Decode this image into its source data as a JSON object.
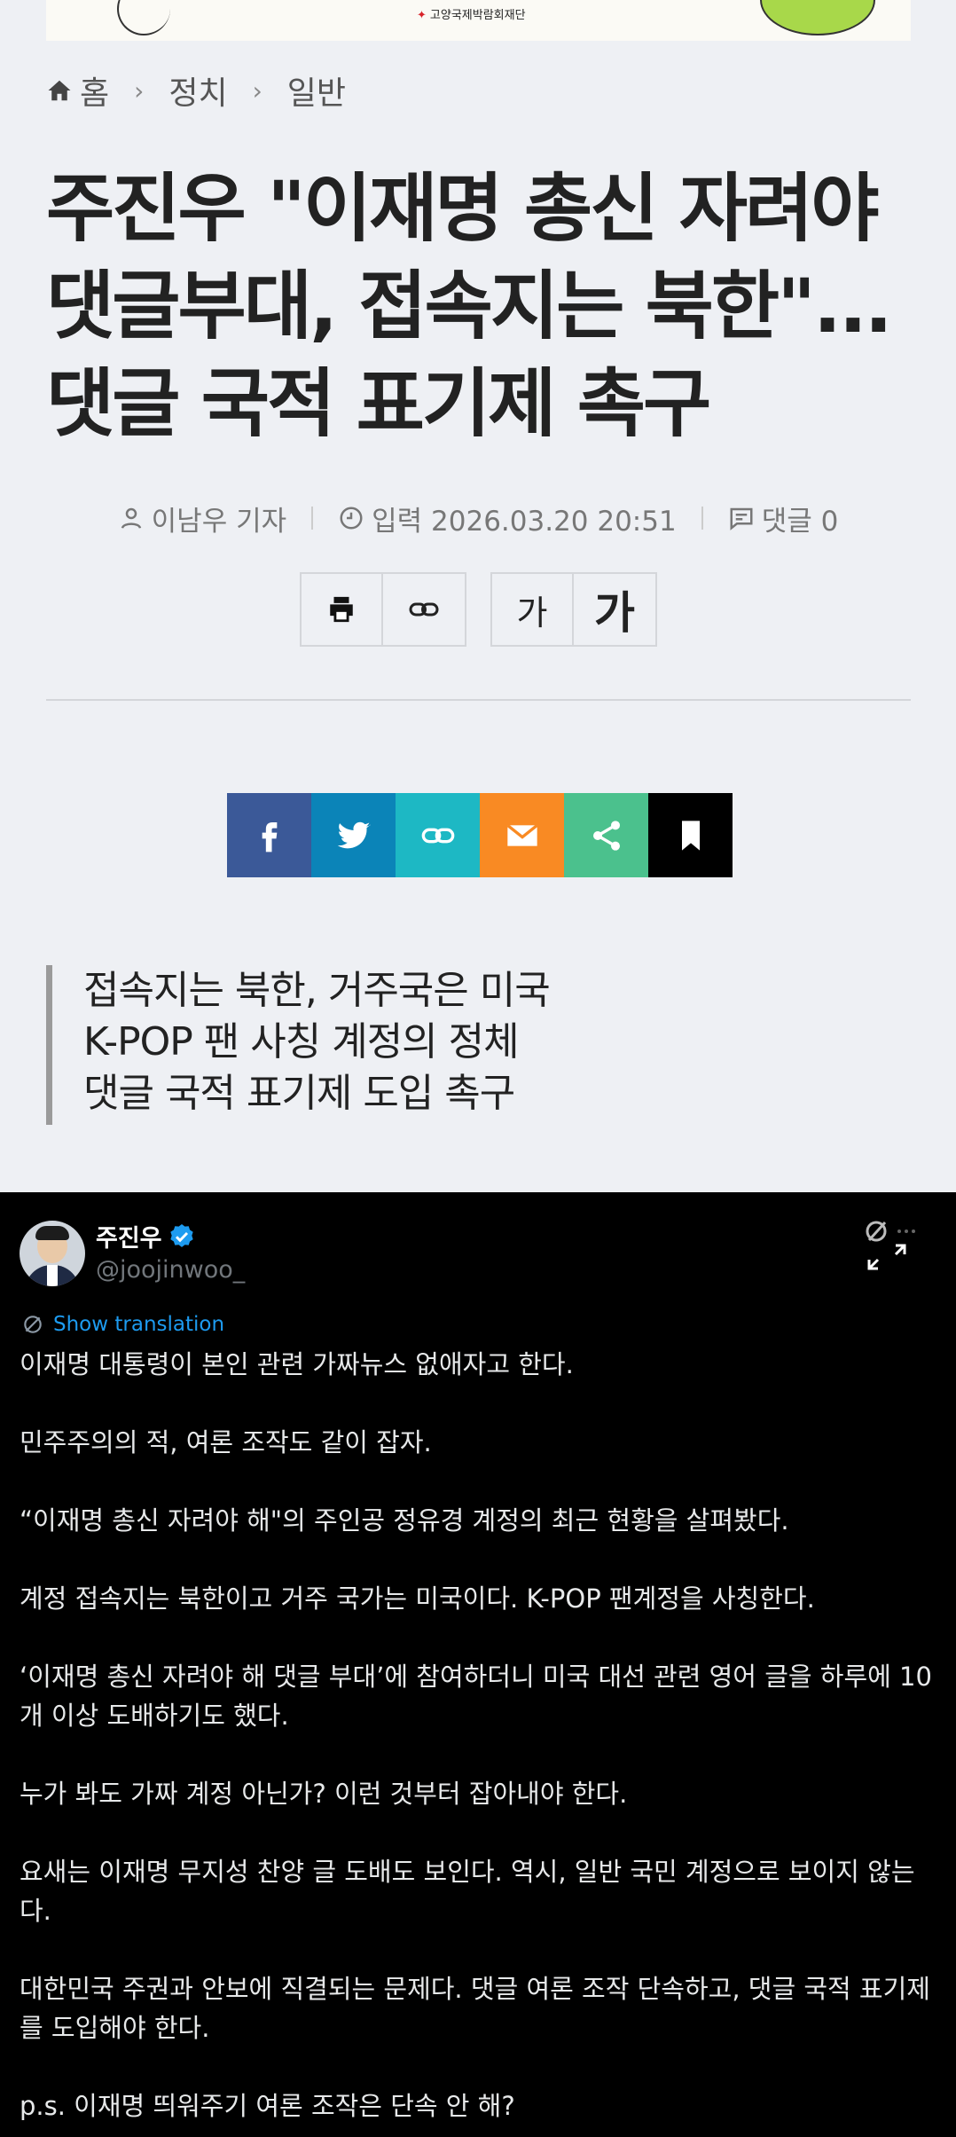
{
  "banner": {
    "logo_text": "고양국제박람회재단"
  },
  "breadcrumb": {
    "home": "홈",
    "section": "정치",
    "subsection": "일반"
  },
  "article": {
    "title": "주진우 \"이재명 총신 자려야 댓글부대, 접속지는 북한\"...댓글 국적 표기제 촉구",
    "author": "이남우 기자",
    "date": "입력 2026.03.20 20:51",
    "comments": "댓글 0"
  },
  "tools": {
    "font_small": "가",
    "font_large": "가"
  },
  "share": {
    "colors": {
      "facebook": "#3b5998",
      "twitter": "#0b84b8",
      "link": "#1db8c4",
      "email": "#f98a23",
      "share": "#4bc18d",
      "bookmark": "#000000"
    }
  },
  "summary": {
    "lines": [
      "접속지는 북한, 거주국은 미국",
      "K-POP 팬 사칭 계정의 정체",
      "댓글 국적 표기제 도입 촉구"
    ]
  },
  "tweet": {
    "name": "주진우",
    "handle": "@joojinwoo_",
    "translate": "Show translation",
    "paragraphs": [
      "이재명 대통령이 본인 관련 가짜뉴스 없애자고 한다.",
      "민주주의의 적, 여론 조작도 같이 잡자.",
      "“이재명 총신 자려야 해\"의 주인공 정유경 계정의 최근 현황을 살펴봤다.",
      "계정 접속지는 북한이고 거주 국가는 미국이다. K-POP 팬계정을 사칭한다.",
      "‘이재명 총신 자려야 해 댓글 부대’에 참여하더니 미국 대선 관련 영어 글을 하루에 10개 이상 도배하기도 했다.",
      "누가 봐도 가짜 계정 아닌가? 이런 것부터 잡아내야 한다.",
      "요새는 이재명 무지성 찬양 글 도배도 보인다. 역시, 일반 국민 계정으로 보이지 않는다.",
      "대한민국 주권과 안보에 직결되는 문제다. 댓글 여론 조작 단속하고, 댓글 국적 표기제를 도입해야 한다.",
      "p.s. 이재명 띄워주기 여론 조작은 단속 안 해?"
    ]
  }
}
